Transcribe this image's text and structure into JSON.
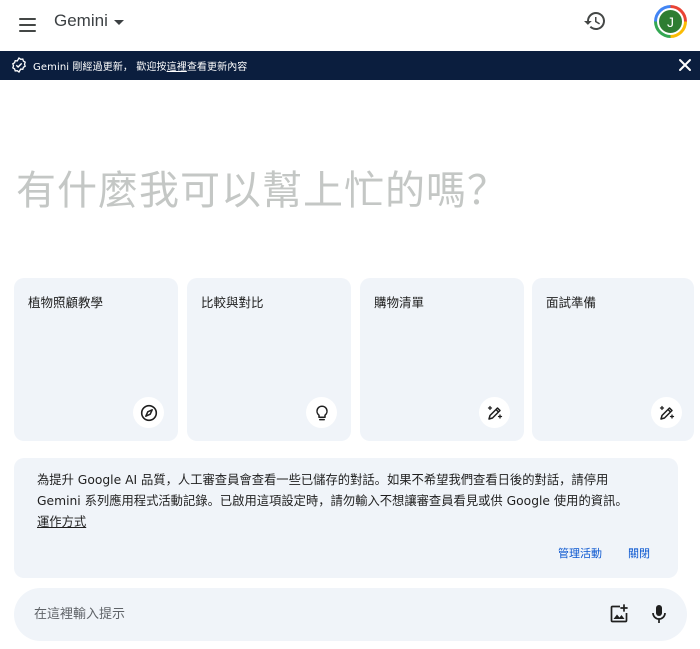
{
  "header": {
    "title": "Gemini",
    "avatar_initial": "J",
    "icons": {
      "menu": "menu-icon",
      "history": "history-icon",
      "caret": "chevron-down-icon"
    }
  },
  "banner": {
    "text_before": "Gemini 剛經過更新， 歡迎按",
    "link": "這裡",
    "text_after": "查看更新內容",
    "background": "#0b1e3e"
  },
  "greeting": "有什麼我可以幫上忙的嗎？",
  "cards": [
    {
      "label": "植物照顧教學",
      "icon": "compass-icon"
    },
    {
      "label": "比較與對比",
      "icon": "lightbulb-icon"
    },
    {
      "label": "購物清單",
      "icon": "pen-sparkle-icon"
    },
    {
      "label": "面試準備",
      "icon": "pen-sparkle-icon"
    }
  ],
  "notice": {
    "line1": "為提升 Google AI 品質，人工審查員會查看一些已儲存的對話。如果不希望我們查看日後的對話，請停用",
    "line2": "Gemini 系列應用程式活動記錄。已啟用這項設定時，請勿輸入不想讓審查員看見或供 Google 使用的資訊。",
    "link": "運作方式",
    "manage_label": "管理活動",
    "close_label": "關閉"
  },
  "prompt": {
    "placeholder": "在這裡輸入提示",
    "value": ""
  },
  "colors": {
    "card_bg": "#f0f4f9",
    "accent": "#0b57d0",
    "greeting": "#c4c7c5"
  }
}
